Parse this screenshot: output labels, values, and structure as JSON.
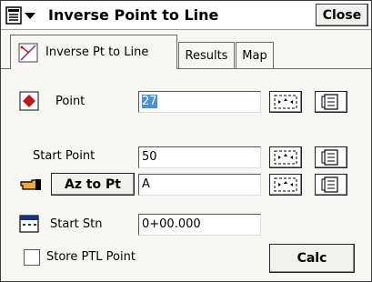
{
  "window": {
    "title": "Inverse Point to Line",
    "close_label": "Close"
  },
  "tabs": [
    {
      "label": "Inverse Pt to Line",
      "active": true
    },
    {
      "label": "Results",
      "active": false
    },
    {
      "label": "Map",
      "active": false
    }
  ],
  "form": {
    "point": {
      "label": "Point",
      "value": "27"
    },
    "start_point": {
      "label": "Start Point",
      "value": "50"
    },
    "az_to_pt": {
      "button_label": "Az to Pt",
      "value": "A"
    },
    "start_stn": {
      "label": "Start Stn",
      "value": "0+00.000"
    },
    "store_ptl": {
      "label": "Store PTL Point",
      "checked": false
    },
    "calc_label": "Calc"
  },
  "colors": {
    "accent_red": "#c0171c",
    "border": "#6d6d6d",
    "selection": "#4a90d9"
  }
}
